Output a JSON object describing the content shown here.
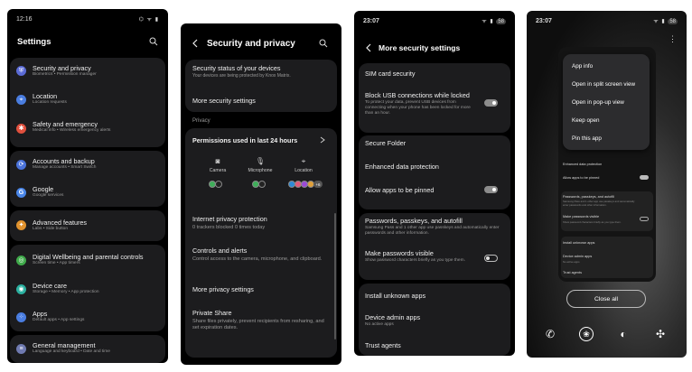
{
  "phone1": {
    "time": "12:16",
    "status_icons": "⌬ ᯤ ▮",
    "title": "Settings",
    "items": [
      {
        "label": "Security and privacy",
        "sub": "Biometrics • Permission manager",
        "color": "#5b6bd6"
      },
      {
        "label": "Location",
        "sub": "Location requests",
        "color": "#4a7de0"
      },
      {
        "label": "Safety and emergency",
        "sub": "Medical info • Wireless emergency alerts",
        "color": "#e0503e"
      },
      {
        "label": "Accounts and backup",
        "sub": "Manage accounts • Smart Switch",
        "color": "#4a72d9"
      },
      {
        "label": "Google",
        "sub": "Google services",
        "color": "#4a86e8"
      },
      {
        "label": "Advanced features",
        "sub": "Labs • Side button",
        "color": "#e0922e"
      },
      {
        "label": "Digital Wellbeing and parental controls",
        "sub": "Screen time • App timers",
        "color": "#3faa4a"
      },
      {
        "label": "Device care",
        "sub": "Storage • Memory • App protection",
        "color": "#2bb0a0"
      },
      {
        "label": "Apps",
        "sub": "Default apps • App settings",
        "color": "#4a7de0"
      },
      {
        "label": "General management",
        "sub": "Language and keyboard • Date and time",
        "color": "#6f7ab0"
      }
    ]
  },
  "phone2": {
    "title": "Security and privacy",
    "status_title": "Security status of your devices",
    "status_sub": "Your devices are being protected by Knox Matrix.",
    "more_security": "More security settings",
    "privacy_header": "Privacy",
    "permissions_title": "Permissions used in last 24 hours",
    "camera": "Camera",
    "microphone": "Microphone",
    "location": "Location",
    "location_badge": "+6",
    "internet_title": "Internet privacy protection",
    "internet_sub": "0 trackers blocked 0 times today",
    "controls_title": "Controls and alerts",
    "controls_sub": "Control access to the camera, microphone, and clipboard.",
    "more_privacy": "More privacy settings",
    "private_share_title": "Private Share",
    "private_share_sub": "Share files privately, prevent recipients from resharing, and set expiration dates."
  },
  "phone3": {
    "time": "23:07",
    "battery": "58",
    "title": "More security settings",
    "sim": "SIM card security",
    "usb_title": "Block USB connections while locked",
    "usb_sub": "To protect your data, prevent USB devices from connecting when your phone has been locked for more than an hour.",
    "secure_folder": "Secure Folder",
    "enhanced": "Enhanced data protection",
    "pinned": "Allow apps to be pinned",
    "passwords_title": "Passwords, passkeys, and autofill",
    "passwords_sub": "Samsung Pass and 1 other app use passkeys and automatically enter passwords and other information.",
    "visible_title": "Make passwords visible",
    "visible_sub": "Show password characters briefly as you type them.",
    "install_unknown": "Install unknown apps",
    "device_admin": "Device admin apps",
    "device_admin_sub": "No active apps",
    "trust_agents": "Trust agents"
  },
  "phone4": {
    "time": "23:07",
    "battery": "58",
    "menu": [
      "App info",
      "Open in split screen view",
      "Open in pop-up view",
      "Keep open",
      "Pin this app"
    ],
    "preview": {
      "enhanced": "Enhanced data protection",
      "pinned": "Allow apps to be pinned",
      "passwords": "Passwords, passkeys, and autofill",
      "passwords_sub": "Samsung Pass and 1 other app use passkeys and automatically enter passwords and other information.",
      "visible": "Make passwords visible",
      "visible_sub": "Show password characters briefly as you type them.",
      "install": "Install unknown apps",
      "admin": "Device admin apps",
      "admin_sub": "No active apps",
      "trust": "Trust agents"
    },
    "close_all": "Close all"
  }
}
